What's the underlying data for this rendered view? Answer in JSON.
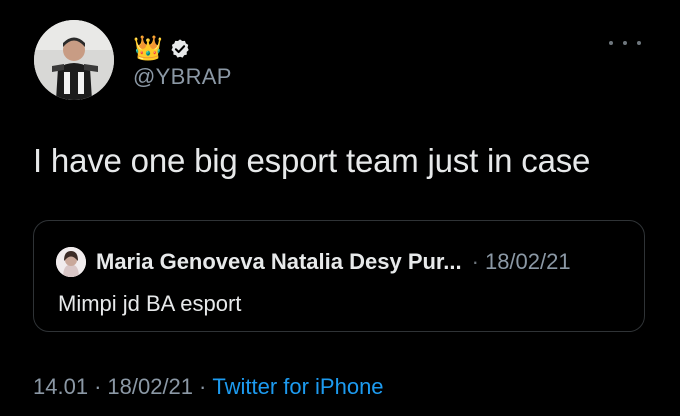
{
  "author": {
    "handle": "@YBRAP",
    "name_emoji": "👑",
    "verified_icon": "verified-badge-icon"
  },
  "tweet": {
    "text": "I have one big esport team just in case"
  },
  "quoted": {
    "name": "Maria Genoveva Natalia Desy Pur...",
    "separator": "·",
    "date": "18/02/21",
    "text": "Mimpi jd BA esport"
  },
  "footer": {
    "time": "14.01",
    "date": "18/02/21",
    "separator": "·",
    "source": "Twitter for iPhone"
  },
  "colors": {
    "background": "#000000",
    "text": "#e7e9ea",
    "secondary": "#8b98a5",
    "accent": "#1d9bf0",
    "border": "#2f3336"
  }
}
